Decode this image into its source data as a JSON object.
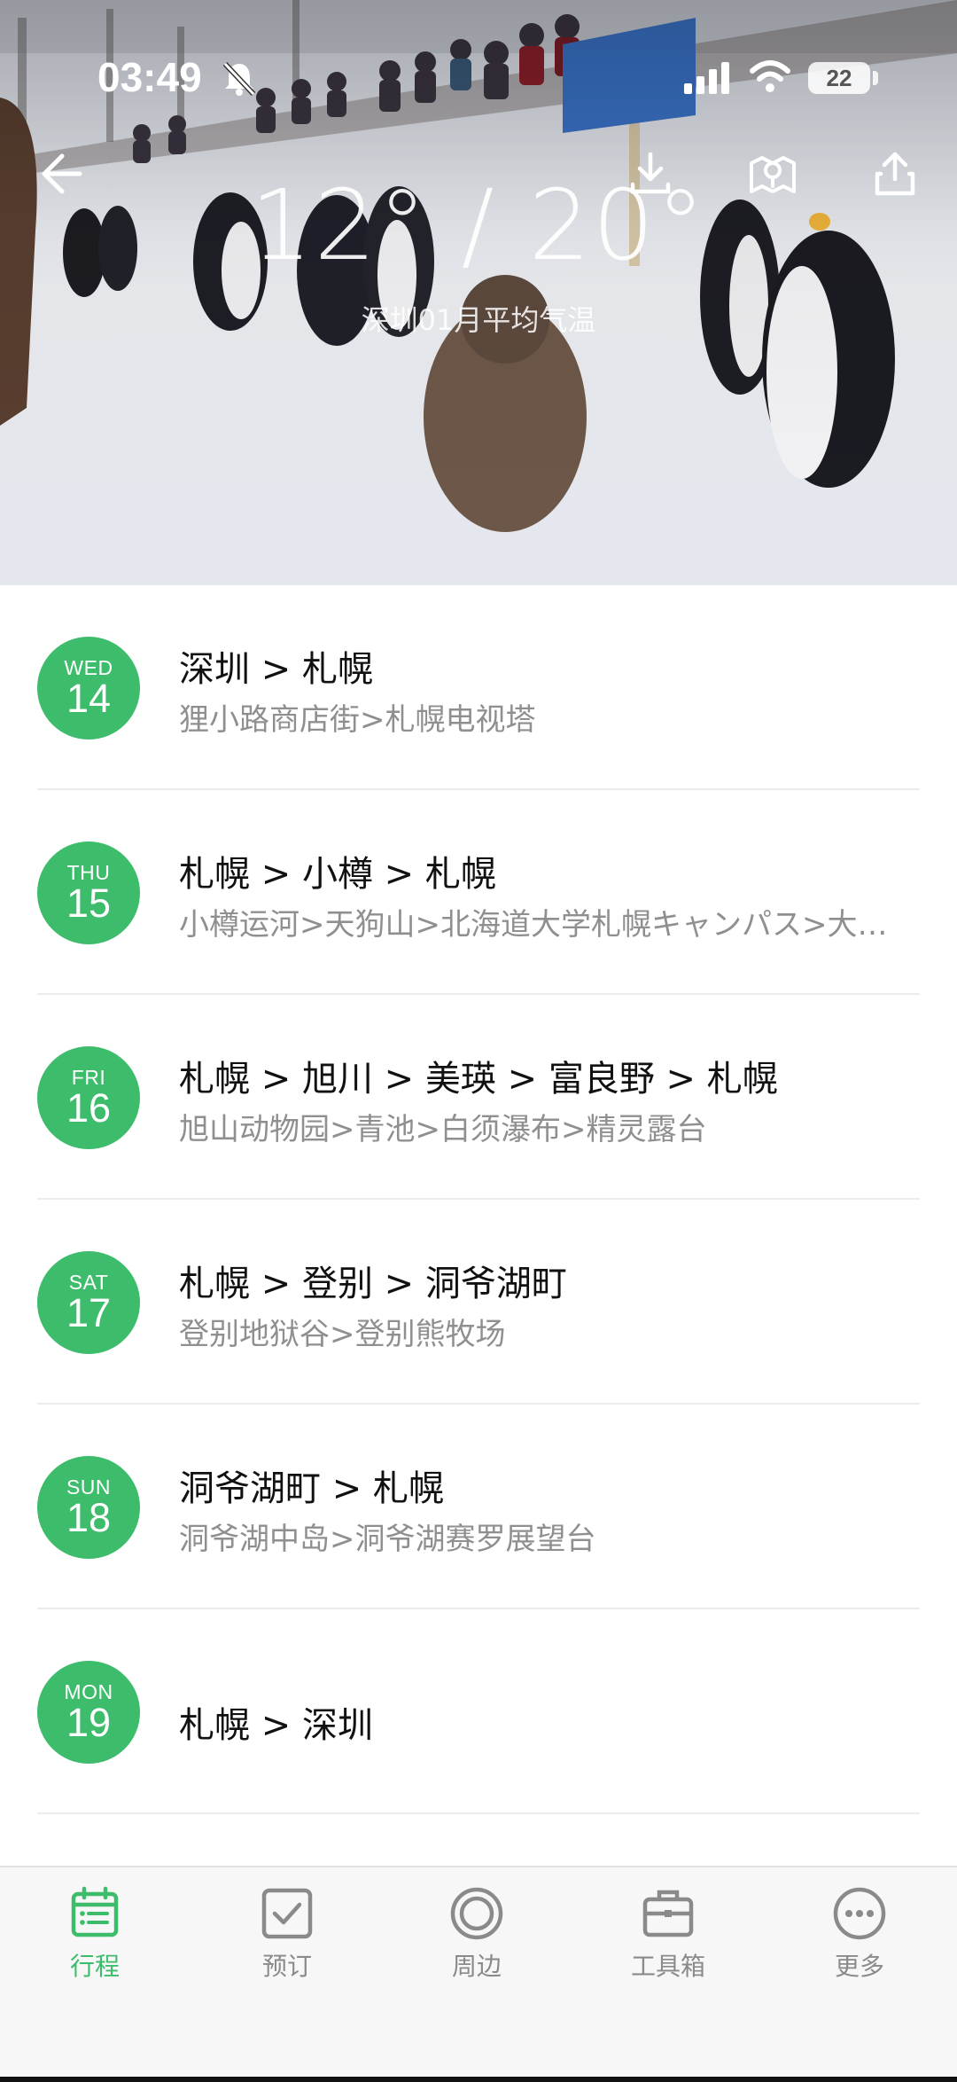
{
  "status_bar": {
    "time": "03:49",
    "battery": "22",
    "icons": [
      "bell-muted-icon",
      "signal-icon",
      "wifi-icon",
      "battery-icon"
    ]
  },
  "header": {
    "back_icon": "back-arrow-icon",
    "actions": [
      "download-icon",
      "map-pin-icon",
      "share-icon"
    ],
    "temperature": "12° / 20°",
    "subtitle": "深圳01月平均气温"
  },
  "itinerary": [
    {
      "dow": "WED",
      "day": "14",
      "route": "深圳 > 札幌",
      "spots": "狸小路商店街>札幌电视塔"
    },
    {
      "dow": "THU",
      "day": "15",
      "route": "札幌 > 小樽 > 札幌",
      "spots": "小樽运河>天狗山>北海道大学札幌キャンパス>大…"
    },
    {
      "dow": "FRI",
      "day": "16",
      "route": "札幌 > 旭川 > 美瑛 > 富良野 > 札幌",
      "spots": "旭山动物园>青池>白须瀑布>精灵露台"
    },
    {
      "dow": "SAT",
      "day": "17",
      "route": "札幌 > 登别 > 洞爷湖町",
      "spots": "登别地狱谷>登别熊牧场"
    },
    {
      "dow": "SUN",
      "day": "18",
      "route": "洞爷湖町 > 札幌",
      "spots": "洞爷湖中岛>洞爷湖赛罗展望台"
    },
    {
      "dow": "MON",
      "day": "19",
      "route": "札幌 > 深圳",
      "spots": ""
    }
  ],
  "tabs": [
    {
      "label": "行程",
      "icon": "itinerary-icon",
      "active": true
    },
    {
      "label": "预订",
      "icon": "checkbox-icon",
      "active": false
    },
    {
      "label": "周边",
      "icon": "nearby-icon",
      "active": false
    },
    {
      "label": "工具箱",
      "icon": "toolbox-icon",
      "active": false
    },
    {
      "label": "更多",
      "icon": "more-icon",
      "active": false
    }
  ],
  "colors": {
    "accent": "#3dbd6b",
    "secondary_text": "#8f8f8f",
    "tab_inactive": "#8a8a8a"
  }
}
